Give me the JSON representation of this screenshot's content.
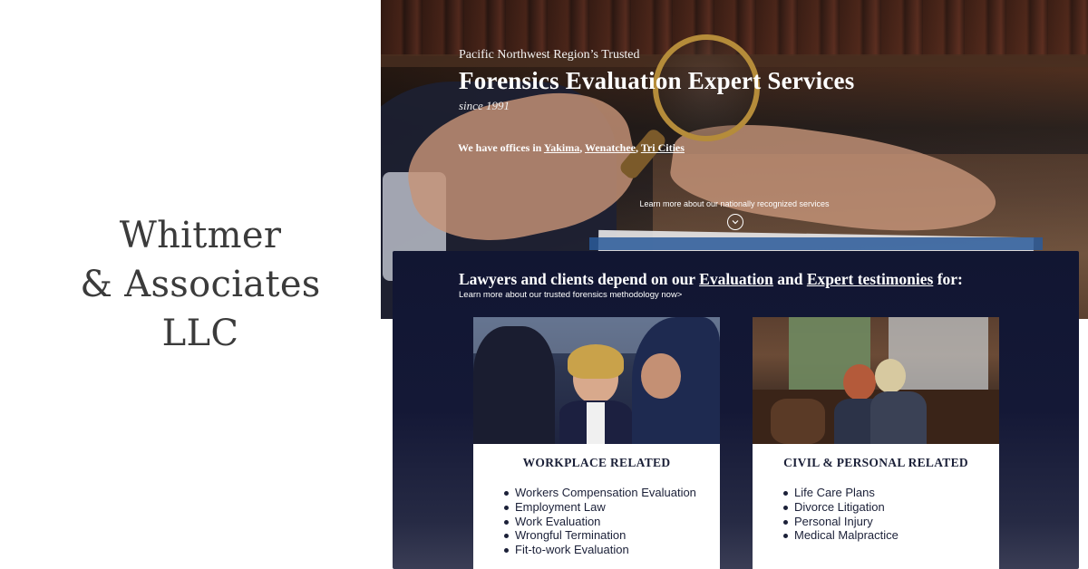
{
  "brand": {
    "lines": [
      "Whitmer",
      "& Associates",
      "LLC"
    ]
  },
  "hero": {
    "eyebrow": "Pacific Northwest Region’s Trusted",
    "title": "Forensics Evaluation Expert Services",
    "since": "since 1991",
    "offices_prefix": "We have offices in ",
    "offices": [
      "Yakima",
      "Wenatchee",
      "Tri Cities"
    ],
    "offices_sep": ", ",
    "learn_more": "Learn more about our nationally recognized services"
  },
  "panel": {
    "heading_prefix": "Lawyers and clients depend on our ",
    "heading_link1": "Evaluation",
    "heading_mid": " and ",
    "heading_link2": "Expert testimonies",
    "heading_suffix": " for:",
    "subheading": "Learn more about our trusted forensics methodology now>"
  },
  "cards": [
    {
      "title": "WORKPLACE RELATED",
      "items": [
        "Workers Compensation Evaluation",
        "Employment Law",
        "Work Evaluation",
        "Wrongful Termination",
        "Fit-to-work Evaluation"
      ]
    },
    {
      "title": "CIVIL & PERSONAL RELATED",
      "items": [
        "Life Care Plans",
        "Divorce Litigation",
        "Personal Injury",
        "Medical Malpractice"
      ]
    }
  ],
  "colors": {
    "panel_bg": "#111632",
    "text_dark": "#1b2038",
    "brand_text": "#3b3b3b"
  }
}
